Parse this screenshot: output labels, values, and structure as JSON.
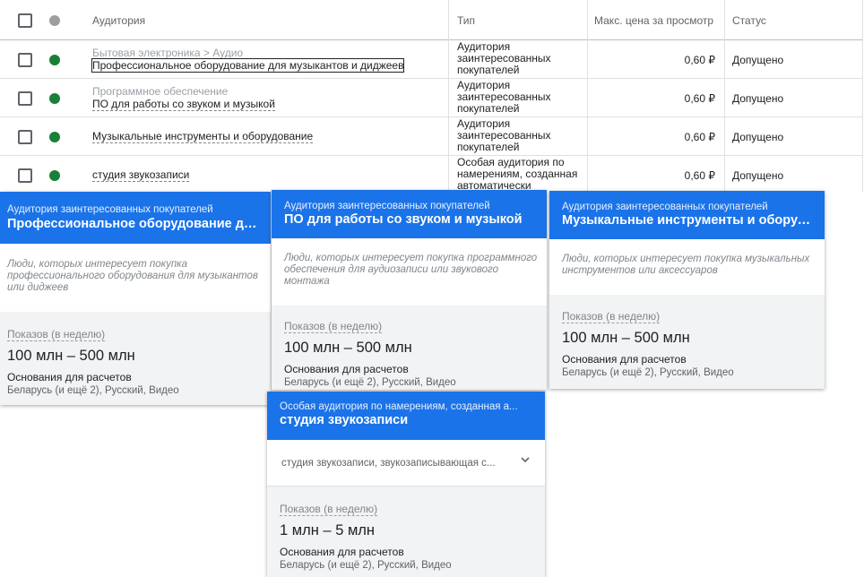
{
  "table": {
    "headers": {
      "audience": "Аудитория",
      "type": "Тип",
      "max_price": "Макс. цена за просмотр",
      "status": "Статус"
    },
    "rows": [
      {
        "category": "Бытовая электроника > Аудио",
        "name": "Профессиональное оборудование для музыкантов и диджеев",
        "type": "Аудитория заинтересованных покупателей",
        "price": "0,60 ₽",
        "status": "Допущено"
      },
      {
        "category": "Программное обеспечение",
        "name": "ПО для работы со звуком и музыкой",
        "type": "Аудитория заинтересованных покупателей",
        "price": "0,60 ₽",
        "status": "Допущено"
      },
      {
        "category": "",
        "name": "Музыкальные инструменты и оборудование",
        "type": "Аудитория заинтересованных покупателей",
        "price": "0,60 ₽",
        "status": "Допущено"
      },
      {
        "category": "",
        "name": "студия звукозаписи",
        "type": "Особая аудитория по намерениям, созданная автоматически",
        "price": "0,60 ₽",
        "status": "Допущено"
      }
    ]
  },
  "cards": [
    {
      "kind": "Аудитория заинтересованных покупателей",
      "title": "Профессиональное оборудование дл...",
      "description": "Люди, которых интересует покупка профессионального оборудования для музыкантов или диджеев",
      "impressions_label": "Показов (в неделю)",
      "impressions_value": "100 млн – 500 млн",
      "basis_label": "Основания для расчетов",
      "basis_value": "Беларусь (и ещё 2), Русский, Видео"
    },
    {
      "kind": "Аудитория заинтересованных покупателей",
      "title": "ПО для работы со звуком и музыкой",
      "description": "Люди, которых интересует покупка программного обеспечения для аудиозаписи или звукового монтажа",
      "impressions_label": "Показов (в неделю)",
      "impressions_value": "100 млн – 500 млн",
      "basis_label": "Основания для расчетов",
      "basis_value": "Беларусь (и ещё 2), Русский, Видео"
    },
    {
      "kind": "Аудитория заинтересованных покупателей",
      "title": "Музыкальные инструменты и оборуд...",
      "description": "Люди, которых интересует покупка музыкальных инструментов или аксессуаров",
      "impressions_label": "Показов (в неделю)",
      "impressions_value": "100 млн – 500 млн",
      "basis_label": "Основания для расчетов",
      "basis_value": "Беларусь (и ещё 2), Русский, Видео"
    },
    {
      "kind": "Особая аудитория по намерениям, созданная а...",
      "title": "студия звукозаписи",
      "keywords": "студия звукозаписи, звукозаписывающая с...",
      "impressions_label": "Показов (в неделю)",
      "impressions_value": "1 млн – 5 млн",
      "basis_label": "Основания для расчетов",
      "basis_value": "Беларусь (и ещё 2), Русский, Видео"
    }
  ],
  "colors": {
    "accent": "#1a73e8",
    "status_ok": "#188038"
  }
}
